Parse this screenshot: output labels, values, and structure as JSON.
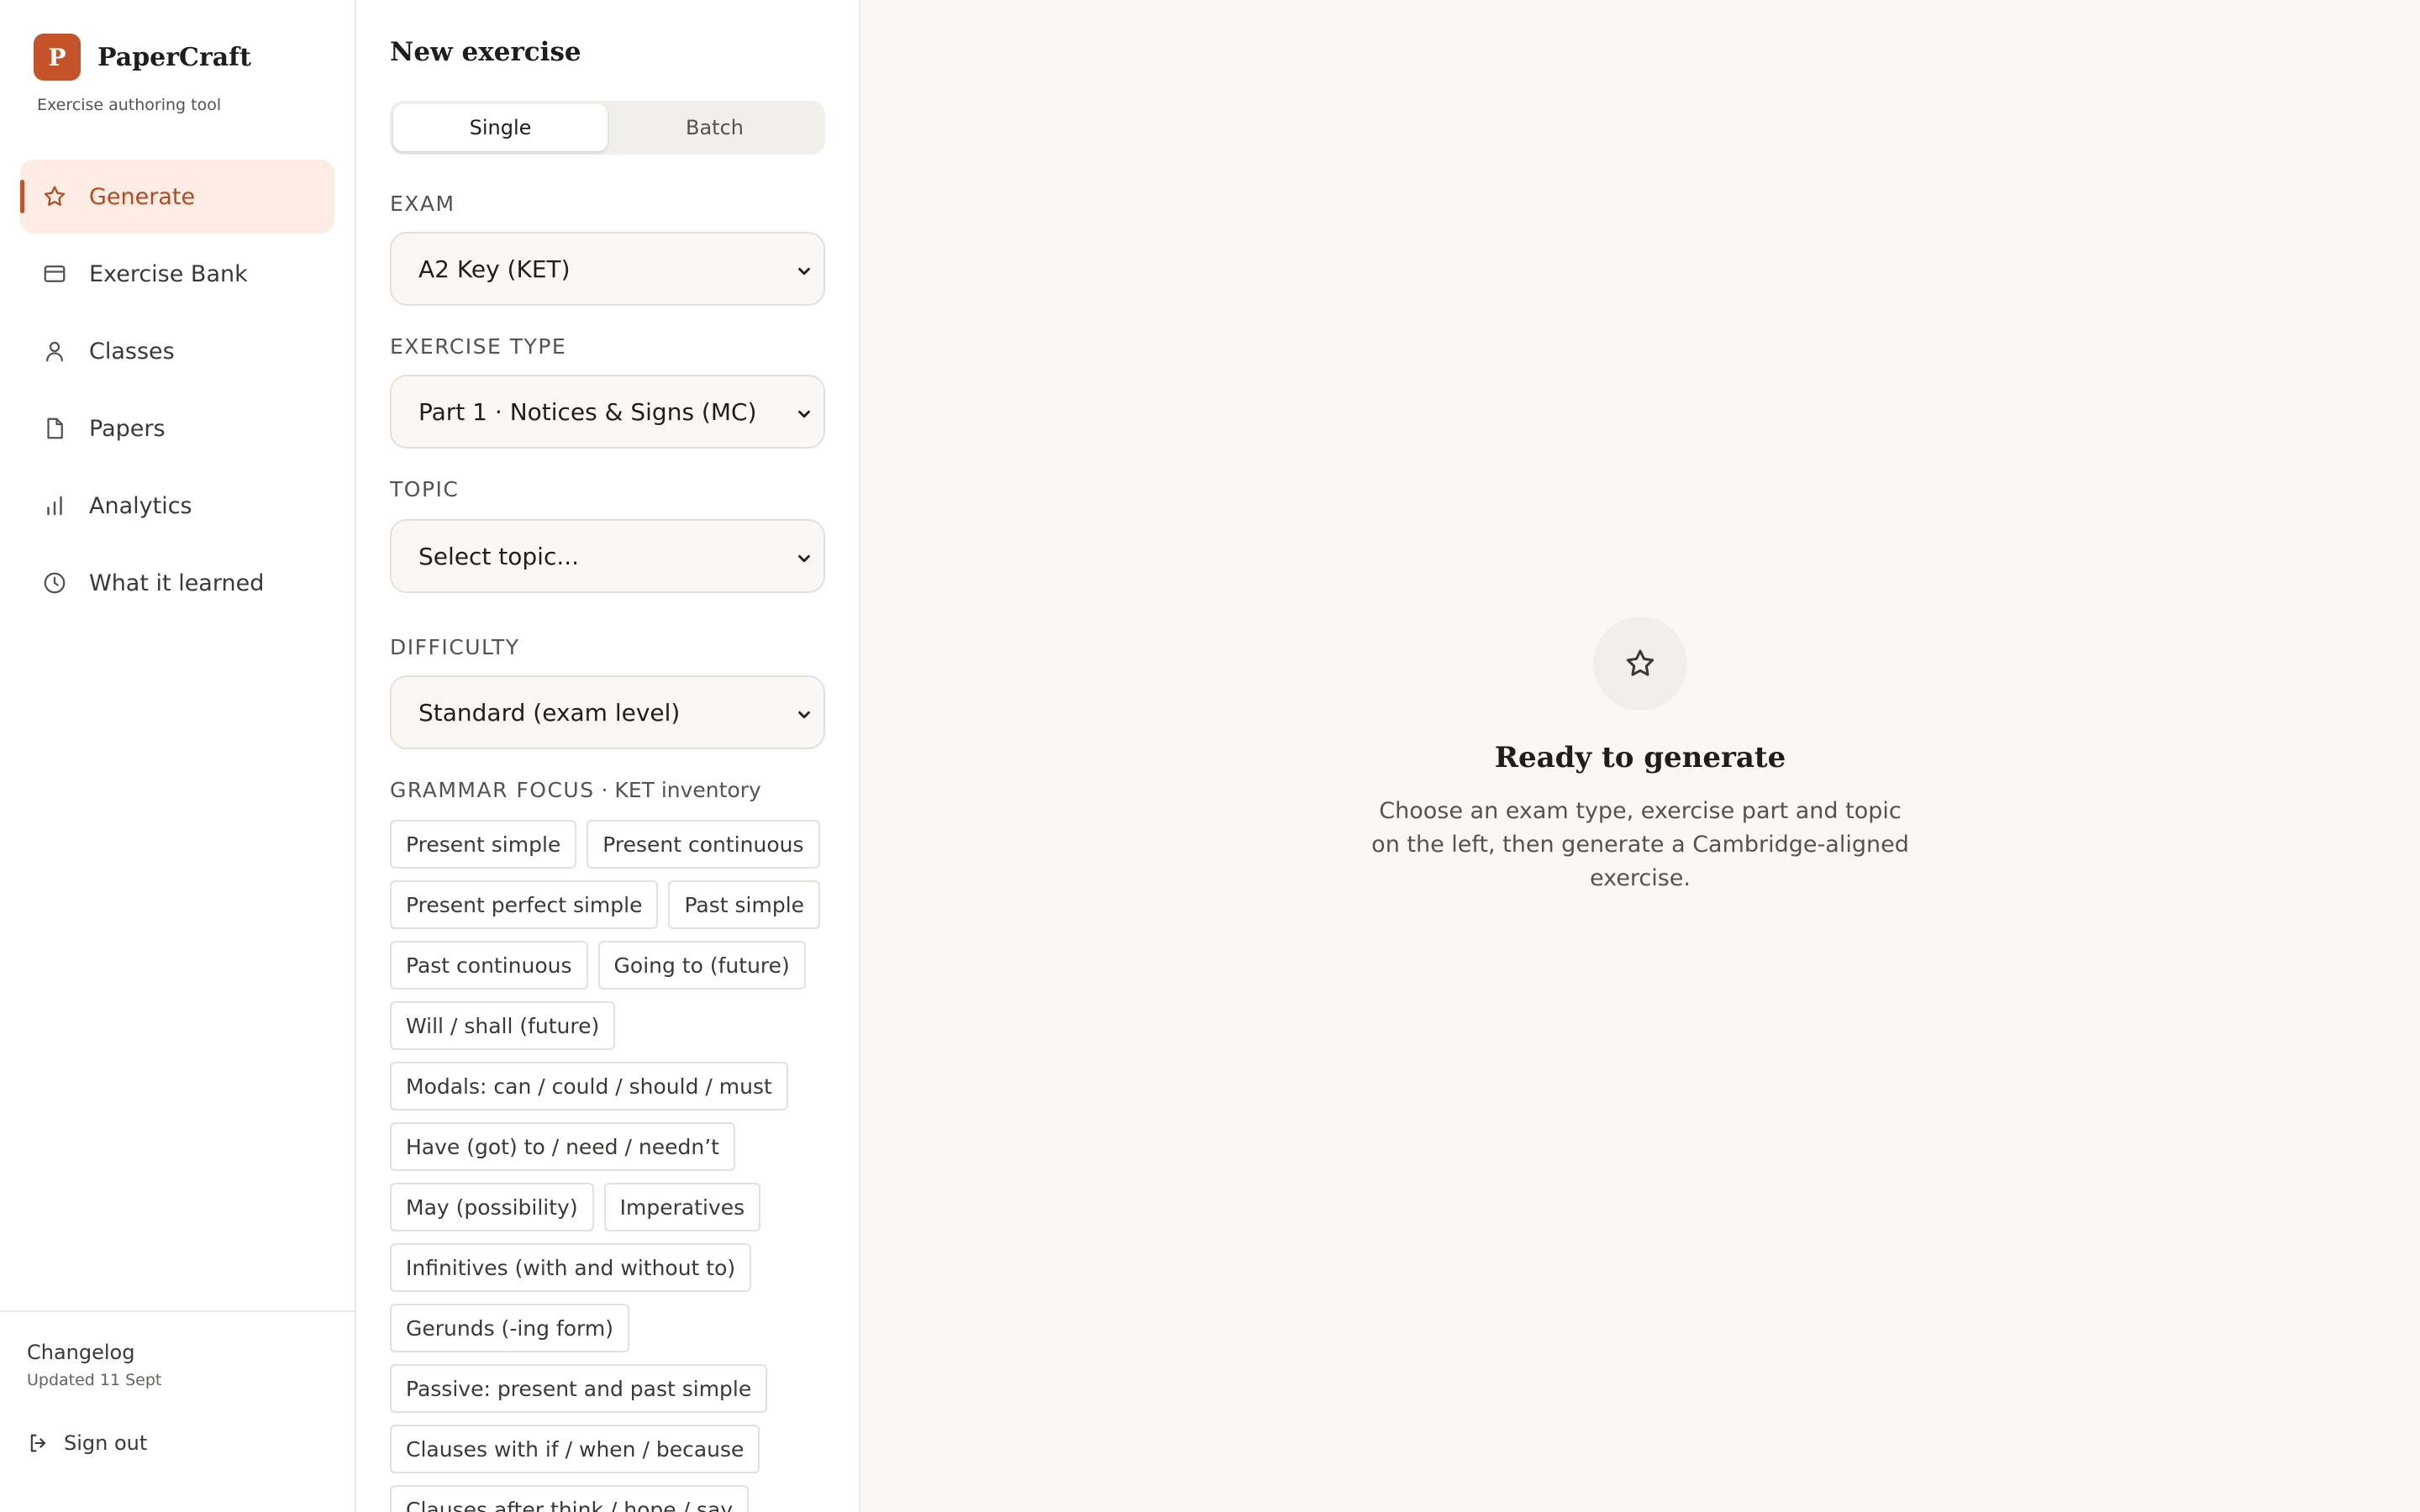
{
  "brand": {
    "logo_letter": "P",
    "name": "PaperCraft",
    "subtitle": "Exercise authoring tool",
    "accent": "#c4532a"
  },
  "nav": {
    "items": [
      {
        "label": "Generate",
        "icon": "star-icon",
        "active": true
      },
      {
        "label": "Exercise Bank",
        "icon": "credit-card-icon",
        "active": false
      },
      {
        "label": "Classes",
        "icon": "user-icon",
        "active": false
      },
      {
        "label": "Papers",
        "icon": "document-icon",
        "active": false
      },
      {
        "label": "Analytics",
        "icon": "bar-chart-icon",
        "active": false
      },
      {
        "label": "What it learned",
        "icon": "clock-icon",
        "active": false
      }
    ]
  },
  "footer": {
    "changelog_title": "Changelog",
    "changelog_sub": "Updated 11 Sept",
    "signout_label": "Sign out"
  },
  "form": {
    "title": "New exercise",
    "modes": [
      {
        "label": "Single",
        "active": true
      },
      {
        "label": "Batch",
        "active": false
      }
    ],
    "exam": {
      "label": "EXAM",
      "value": "A2 Key (KET)"
    },
    "exercise_type": {
      "label": "EXERCISE TYPE",
      "value": "Part 1 · Notices & Signs (MC)"
    },
    "topic": {
      "label": "TOPIC",
      "value": "Select topic..."
    },
    "difficulty": {
      "label": "DIFFICULTY",
      "value": "Standard (exam level)"
    },
    "grammar": {
      "label": "GRAMMAR FOCUS",
      "sub": " · KET inventory",
      "chips": [
        "Present simple",
        "Present continuous",
        "Present perfect simple",
        "Past simple",
        "Past continuous",
        "Going to (future)",
        "Will / shall (future)",
        "Modals: can / could / should / must",
        "Have (got) to / need / needn’t",
        "May (possibility)",
        "Imperatives",
        "Infinitives (with and without to)",
        "Gerunds (-ing form)",
        "Passive: present and past simple",
        "Clauses with if / when / because",
        "Clauses after think / hope / say"
      ]
    }
  },
  "empty_state": {
    "icon": "star-icon",
    "title": "Ready to generate",
    "description": "Choose an exam type, exercise part and topic on the left, then generate a Cambridge-aligned exercise."
  }
}
